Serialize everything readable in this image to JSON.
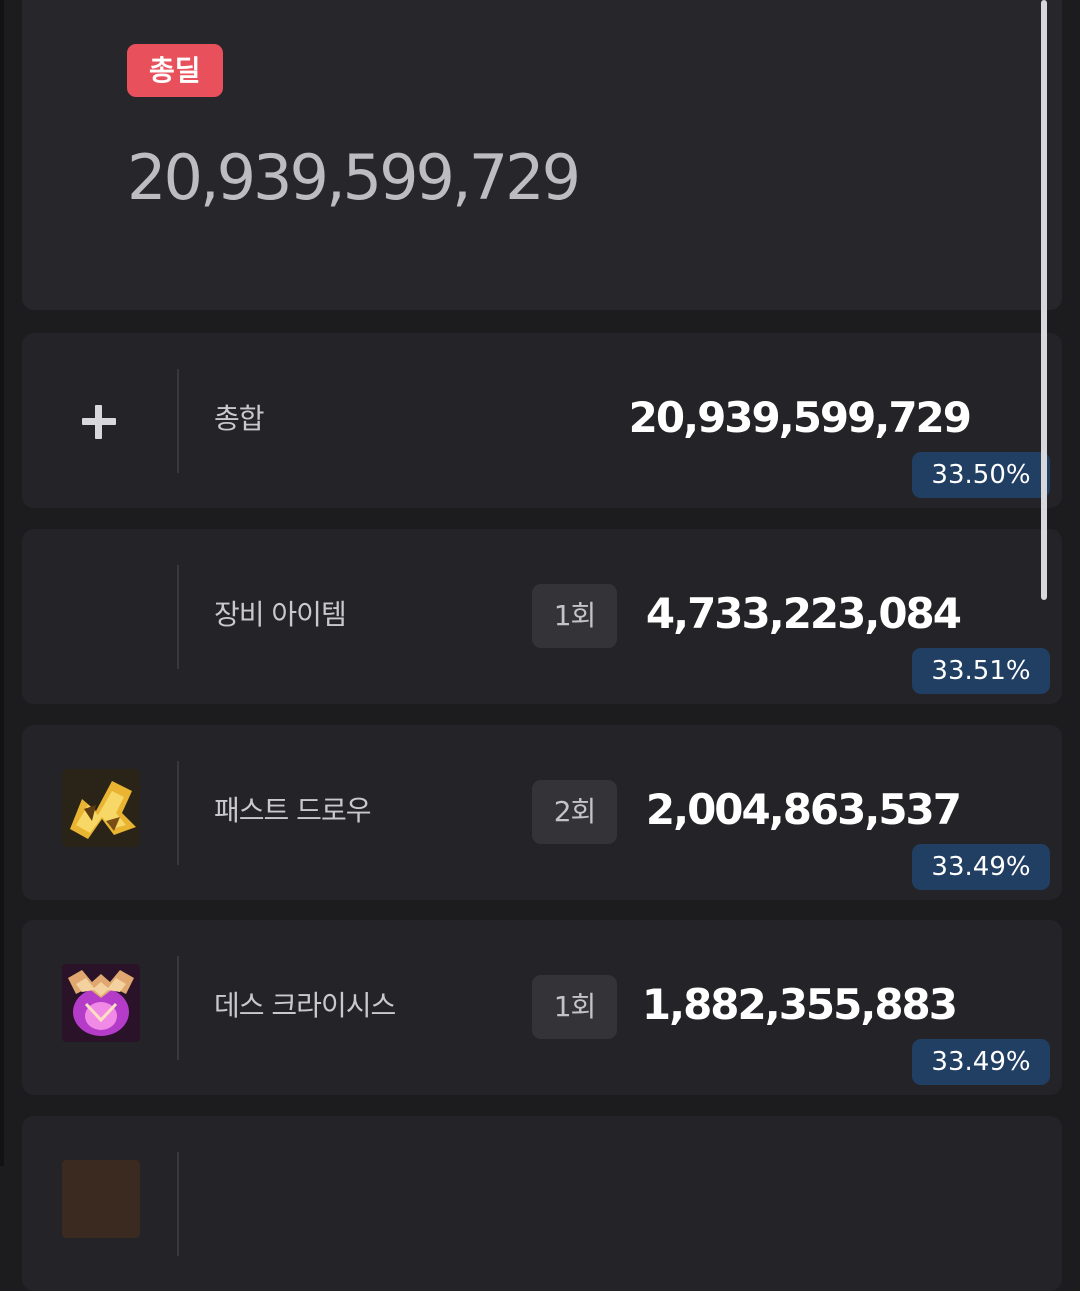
{
  "summary": {
    "badge_label": "총딜",
    "total_value": "20,939,599,729"
  },
  "rows": [
    {
      "icon": "plus-icon",
      "label": "총합",
      "count": "",
      "value": "20,939,599,729",
      "percent": "33.50%"
    },
    {
      "icon": "",
      "label": "장비 아이템",
      "count": "1회",
      "value": "4,733,223,084",
      "percent": "33.51%"
    },
    {
      "icon": "fast-draw-skill-icon",
      "label": "패스트 드로우",
      "count": "2회",
      "value": "2,004,863,537",
      "percent": "33.49%"
    },
    {
      "icon": "death-crisis-skill-icon",
      "label": "데스 크라이시스",
      "count": "1회",
      "value": "1,882,355,883",
      "percent": "33.49%"
    }
  ],
  "colors": {
    "badge_red": "#e8505b",
    "percent_blue": "#213e63",
    "card_bg": "#242428",
    "page_bg": "#1c1c1e"
  }
}
